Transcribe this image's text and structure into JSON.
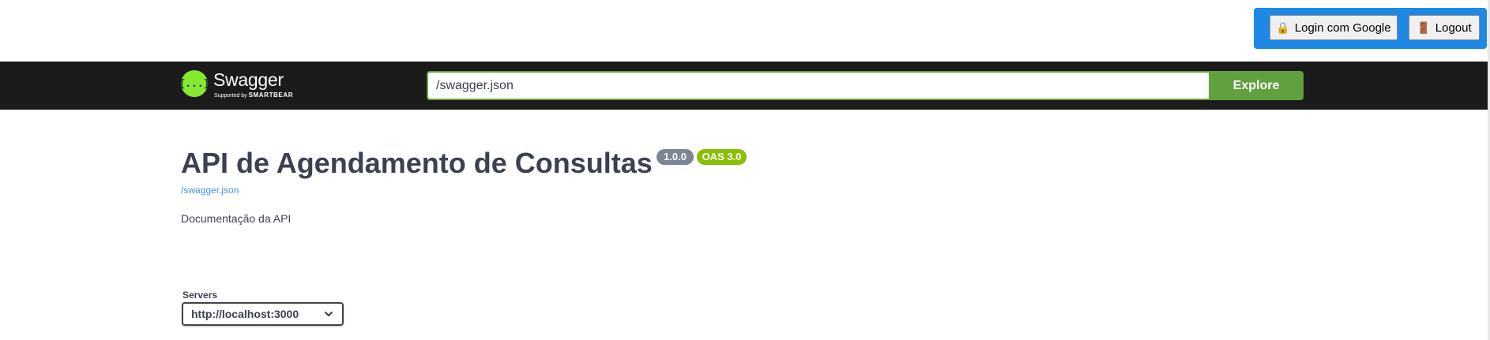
{
  "auth": {
    "login_label": "Login com Google",
    "login_icon": "lock-icon",
    "logout_label": "Logout",
    "logout_icon": "door-icon",
    "panel_color": "#1e88e5"
  },
  "topbar": {
    "logo_text": "Swagger",
    "logo_supported_by": "Supported by",
    "logo_company": "SMARTBEAR",
    "logo_glyph": "{...}",
    "url_value": "/swagger.json",
    "explore_label": "Explore",
    "background_color": "#1b1b1b",
    "accent_color": "#62a03f"
  },
  "info": {
    "title": "API de Agendamento de Consultas",
    "version_badge": "1.0.0",
    "oas_badge": "OAS 3.0",
    "spec_link": "/swagger.json",
    "description": "Documentação da API"
  },
  "servers": {
    "label": "Servers",
    "selected": "http://localhost:3000"
  }
}
